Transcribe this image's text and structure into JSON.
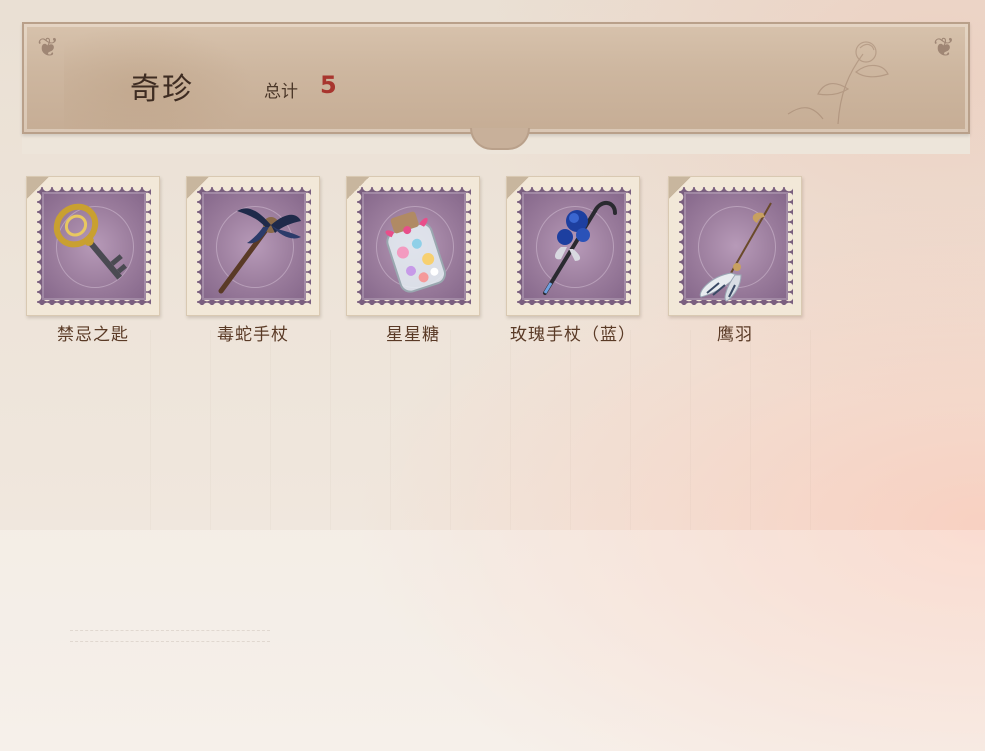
{
  "header": {
    "title": "奇珍",
    "total_label": "总计",
    "total_count": "5"
  },
  "items": [
    {
      "name": "禁忌之匙",
      "icon": "forbidden-key-icon"
    },
    {
      "name": "毒蛇手杖",
      "icon": "viper-staff-icon"
    },
    {
      "name": "星星糖",
      "icon": "star-candy-jar-icon"
    },
    {
      "name": "玫瑰手杖（蓝）",
      "icon": "blue-rose-cane-icon"
    },
    {
      "name": "鹰羽",
      "icon": "eagle-feather-icon"
    }
  ],
  "colors": {
    "banner": "#cdb69f",
    "stamp_purple": "#9a7c9c",
    "count_red": "#a8352e",
    "label_brown": "#5a3a26"
  }
}
